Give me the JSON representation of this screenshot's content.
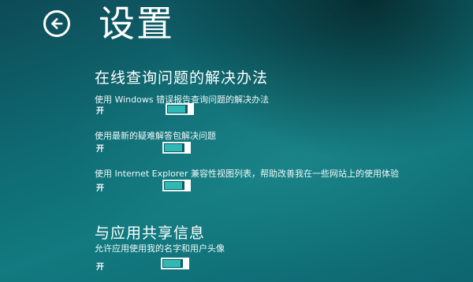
{
  "header": {
    "title": "设置",
    "back_icon": "back-arrow-icon"
  },
  "sections": [
    {
      "title": "在线查询问题的解决办法",
      "settings": [
        {
          "label": "使用 Windows 错误报告查询问题的解决办法",
          "state": "开",
          "on": true
        },
        {
          "label": "使用最新的疑难解答包解决问题",
          "state": "开",
          "on": true
        },
        {
          "label": "使用 Internet Explorer 兼容性视图列表，帮助改善我在一些网站上的使用体验",
          "state": "开",
          "on": true
        }
      ]
    },
    {
      "title": "与应用共享信息",
      "settings": [
        {
          "label": "允许应用使用我的名字和用户头像",
          "state": "开",
          "on": true
        }
      ]
    }
  ],
  "colors": {
    "background": "#0f6a72",
    "toggle_on": "#2fb9b5",
    "text": "#ffffff"
  }
}
